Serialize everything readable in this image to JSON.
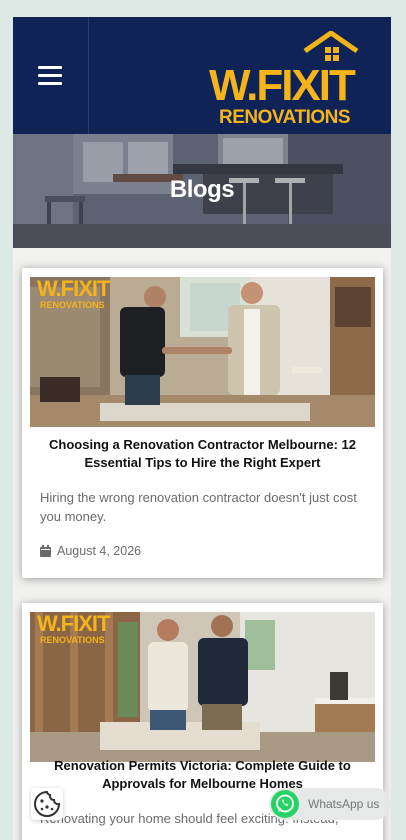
{
  "header": {
    "menu_icon": "hamburger-menu-icon",
    "logo_line1": "W.FIXIT",
    "logo_line2": "RENOVATIONS",
    "colors": {
      "navy": "#0f2356",
      "gold": "#f4b41a"
    }
  },
  "hero": {
    "title": "Blogs"
  },
  "posts": [
    {
      "thumb_logo_line1": "W.FIXIT",
      "thumb_logo_line2": "RENOVATIONS",
      "title": "Choosing a Renovation Contractor Melbourne: 12 Essential Tips to Hire the Right Expert",
      "excerpt": "Hiring the wrong renovation contractor doesn't just cost you money.",
      "date_icon": "calendar-icon",
      "date": "August 4, 2026"
    },
    {
      "thumb_logo_line1": "W.FIXIT",
      "thumb_logo_line2": "RENOVATIONS",
      "title": "Renovation Permits Victoria: Complete Guide to Approvals for Melbourne Homes",
      "excerpt": "Renovating your home should feel exciting. Instead,"
    }
  ],
  "whatsapp": {
    "icon": "whatsapp-icon",
    "label": "WhatsApp us",
    "color": "#25d366"
  },
  "cookie": {
    "icon": "cookie-icon"
  }
}
